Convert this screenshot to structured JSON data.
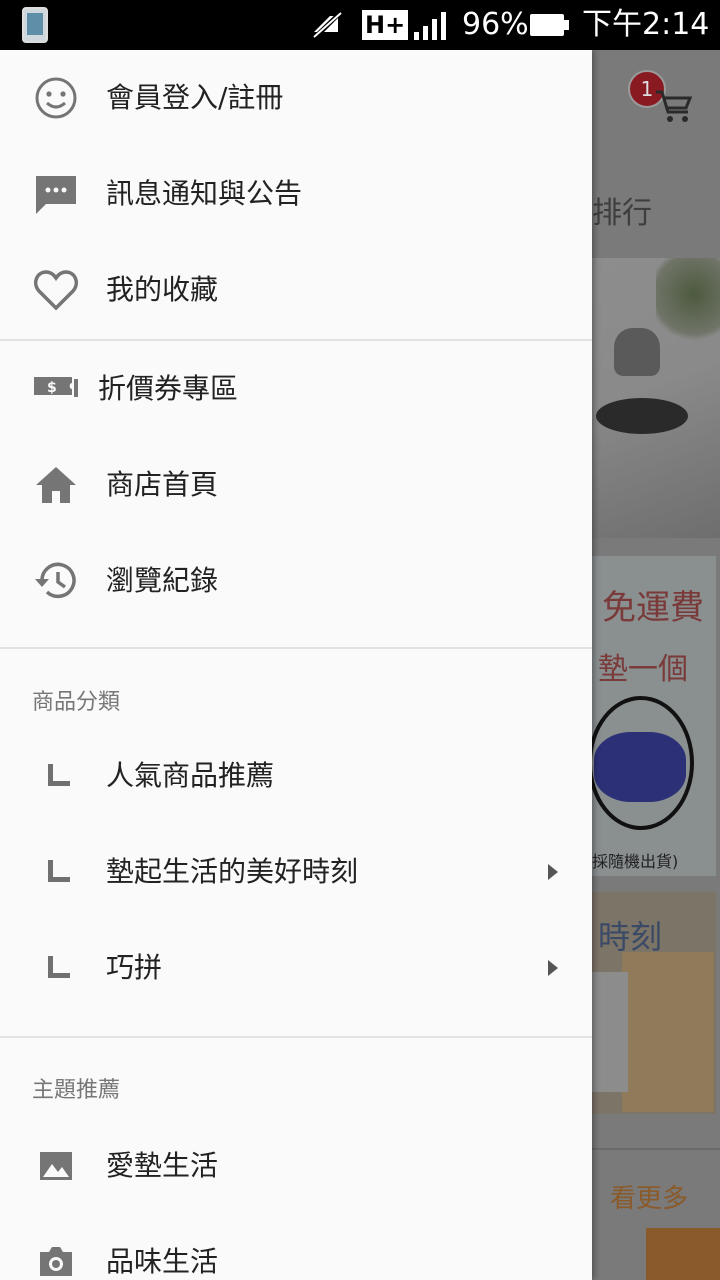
{
  "status_bar": {
    "network": "H+",
    "battery_percent": "96%",
    "time": "下午2:14"
  },
  "background": {
    "cart_badge": "1",
    "rank_text": "排行",
    "promo_line1": "免運費",
    "promo_line2": "墊一個",
    "promo_note": "採隨機出貨)",
    "banner_text": "時刻",
    "see_more": "看更多"
  },
  "drawer": {
    "account": [
      {
        "id": "login",
        "label": "會員登入/註冊",
        "icon": "smiley-icon"
      },
      {
        "id": "messages",
        "label": "訊息通知與公告",
        "icon": "chat-bubble-icon"
      },
      {
        "id": "favorites",
        "label": "我的收藏",
        "icon": "heart-icon"
      }
    ],
    "shop": [
      {
        "id": "coupons",
        "label": "折價券專區",
        "icon": "coupon-icon"
      },
      {
        "id": "home",
        "label": "商店首頁",
        "icon": "home-icon"
      },
      {
        "id": "history",
        "label": "瀏覽紀錄",
        "icon": "history-icon"
      }
    ],
    "categories_header": "商品分類",
    "categories": [
      {
        "id": "popular",
        "label": "人氣商品推薦",
        "has_submenu": false
      },
      {
        "id": "mat-life",
        "label": "墊起生活的美好時刻",
        "has_submenu": true
      },
      {
        "id": "puzzle",
        "label": "巧拼",
        "has_submenu": true
      }
    ],
    "themes_header": "主題推薦",
    "themes": [
      {
        "id": "love-mat",
        "label": "愛墊生活",
        "icon": "image-icon"
      },
      {
        "id": "taste-life",
        "label": "品味生活",
        "icon": "camera-icon"
      }
    ]
  },
  "colors": {
    "drawer_bg": "#fafafa",
    "icon_gray": "#757575",
    "text": "#222222",
    "badge": "#8a1a22"
  }
}
